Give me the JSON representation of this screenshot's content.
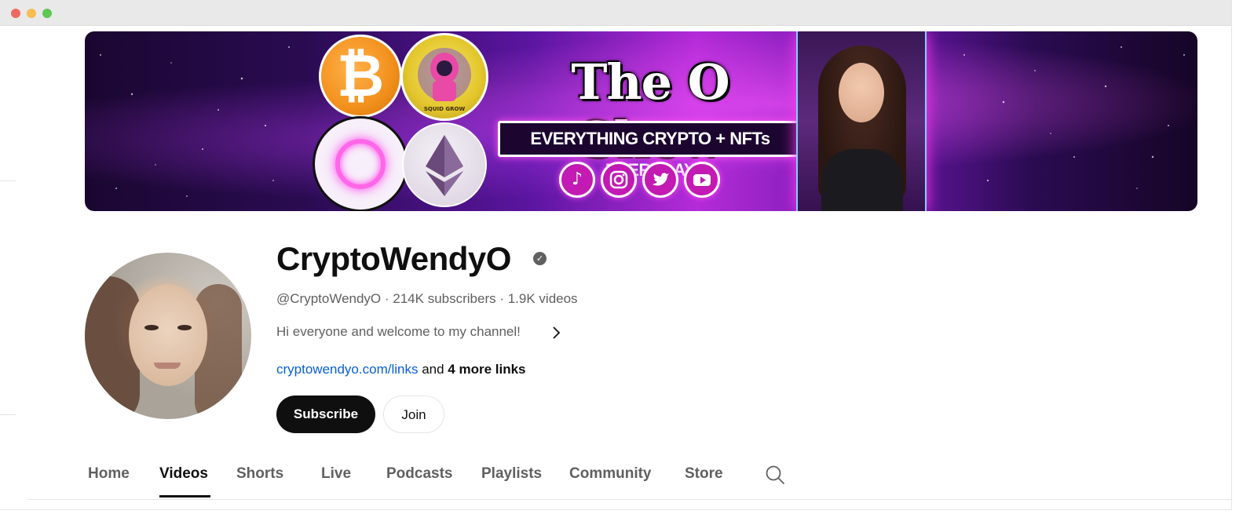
{
  "banner": {
    "show_title": "The O Show",
    "tagline": "EVERYTHING CRYPTO + NFTs EVERYDAY",
    "coin_labels": {
      "btc": "₿",
      "squid": "SQUID GROW"
    },
    "social_icons": [
      "tiktok-icon",
      "instagram-icon",
      "twitter-icon",
      "youtube-icon"
    ]
  },
  "channel": {
    "name": "CryptoWendyO",
    "verified_mark": "✓",
    "handle": "@CryptoWendyO",
    "subscribers": "214K subscribers",
    "videos": "1.9K videos",
    "separator": " · ",
    "description": "Hi everyone and welcome to my channel!",
    "link": "cryptowendyo.com/links",
    "link_connector": " and ",
    "more_links": "4 more links"
  },
  "buttons": {
    "subscribe": "Subscribe",
    "join": "Join"
  },
  "tabs": [
    {
      "label": "Home"
    },
    {
      "label": "Videos"
    },
    {
      "label": "Shorts"
    },
    {
      "label": "Live"
    },
    {
      "label": "Podcasts"
    },
    {
      "label": "Playlists"
    },
    {
      "label": "Community"
    },
    {
      "label": "Store"
    }
  ],
  "active_tab": "Videos",
  "colors": {
    "link": "#065fd4",
    "subscribe_bg": "#0f0f0f",
    "banner_accent": "#ff3cf0"
  }
}
